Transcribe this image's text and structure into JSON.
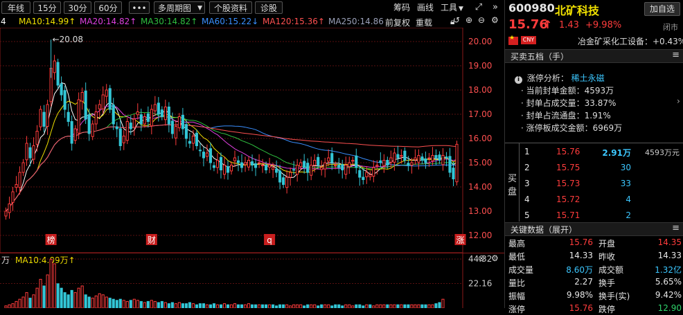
{
  "toolbar": {
    "btn_daily": "年线",
    "btn_15": "15分",
    "btn_30": "30分",
    "btn_60": "60分",
    "btn_more": "•••",
    "btn_multi": "多周期图",
    "btn_profile": "个股资料",
    "btn_diag": "诊股",
    "link_chips": "筹码",
    "link_draw": "画线",
    "link_tools": "工具"
  },
  "ma_bar": {
    "prefix": "4",
    "ma10": "MA10:14.99↑",
    "ma20": "MA20:14.82↑",
    "ma30": "MA30:14.82↑",
    "ma60": "MA60:15.22↓",
    "ma120": "MA120:15.36↑",
    "ma250": "MA250:14.86",
    "adj": "前复权",
    "redraw": "重载"
  },
  "colors": {
    "up": "#ff3c3c",
    "down": "#33c6d6",
    "ma5": "#ffffff",
    "ma10": "#f0e000",
    "ma20": "#e040e0",
    "ma30": "#2fbf3f",
    "ma60": "#3a8fff",
    "ma120": "#ff5050",
    "ma250": "#9aa0b8"
  },
  "chart_data": {
    "type": "candlestick",
    "ylim": [
      12.0,
      20.2
    ],
    "y_ticks": [
      "20.00",
      "19.00",
      "18.00",
      "17.00",
      "16.00",
      "15.00",
      "14.00",
      "13.00",
      "12.00"
    ],
    "y_tick_values": [
      20,
      19,
      18,
      17,
      16,
      15,
      14,
      13,
      12
    ],
    "annotation_high": "←20.08",
    "high_value": 20.08,
    "markers": [
      {
        "label": "榜",
        "index": 13
      },
      {
        "label": "财",
        "index": 42
      },
      {
        "label": "q",
        "index": 76
      },
      {
        "label": "涨",
        "index": 131
      }
    ],
    "closes": [
      13.0,
      13.3,
      13.8,
      14.1,
      14.6,
      15.0,
      15.8,
      15.2,
      15.7,
      16.3,
      17.2,
      16.5,
      17.4,
      18.9,
      19.2,
      18.2,
      17.8,
      17.2,
      16.7,
      15.8,
      16.4,
      17.6,
      17.9,
      16.8,
      16.2,
      16.6,
      17.1,
      17.4,
      17.8,
      18.0,
      17.2,
      16.6,
      16.4,
      15.7,
      16.1,
      16.7,
      16.4,
      16.8,
      17.1,
      16.6,
      16.9,
      16.7,
      17.2,
      17.4,
      17.0,
      16.9,
      17.3,
      16.6,
      16.2,
      16.5,
      16.9,
      16.4,
      16.0,
      15.8,
      16.1,
      15.7,
      15.5,
      15.2,
      15.4,
      15.0,
      14.8,
      15.1,
      14.7,
      14.9,
      14.6,
      14.9,
      15.2,
      15.0,
      14.8,
      15.0,
      15.1,
      14.9,
      14.8,
      15.0,
      14.9,
      14.7,
      14.9,
      14.8,
      14.6,
      14.2,
      14.1,
      14.4,
      14.6,
      14.7,
      14.9,
      15.0,
      14.8,
      14.6,
      14.9,
      15.1,
      14.9,
      14.8,
      15.0,
      15.2,
      15.0,
      14.9,
      14.8,
      14.7,
      14.9,
      15.0,
      15.1,
      14.8,
      14.4,
      14.3,
      14.6,
      14.5,
      14.8,
      14.9,
      15.0,
      15.1,
      14.9,
      15.2,
      15.4,
      15.2,
      15.3,
      15.1,
      14.9,
      15.0,
      15.2,
      15.3,
      15.1,
      15.0,
      15.2,
      15.3,
      15.2,
      15.1,
      15.3,
      15.2,
      14.6,
      14.33,
      15.76
    ],
    "volume": {
      "label_ma10": "MA10:4.09万↑",
      "label_prefix": "万",
      "y_ticks": [
        "44.32",
        "22.16"
      ],
      "y_tick_values": [
        44.32,
        22.16
      ],
      "ylim": [
        0,
        50
      ],
      "values": [
        2,
        3,
        4,
        6,
        8,
        10,
        14,
        9,
        12,
        18,
        26,
        20,
        30,
        44,
        40,
        22,
        18,
        14,
        12,
        16,
        14,
        18,
        20,
        12,
        10,
        9,
        11,
        13,
        12,
        10,
        9,
        8,
        7,
        8,
        7,
        6,
        7,
        8,
        7,
        6,
        5,
        6,
        7,
        6,
        5,
        6,
        5,
        4,
        5,
        4,
        5,
        4,
        4,
        5,
        4,
        3,
        4,
        4,
        3,
        3,
        4,
        3,
        3,
        4,
        3,
        3,
        4,
        3,
        3,
        3,
        4,
        3,
        3,
        3,
        3,
        3,
        3,
        3,
        2,
        3,
        3,
        3,
        2,
        3,
        3,
        3,
        2,
        3,
        3,
        3,
        2,
        3,
        3,
        3,
        2,
        3,
        3,
        2,
        3,
        3,
        2,
        3,
        3,
        2,
        3,
        3,
        2,
        3,
        3,
        3,
        3,
        3,
        3,
        3,
        3,
        3,
        3,
        3,
        3,
        3,
        3,
        3,
        3,
        3,
        4,
        5,
        8
      ]
    }
  },
  "quote": {
    "code": "600980",
    "name": "北矿科技",
    "add_fav": "加自选",
    "price": "15.76",
    "arrow": "↑",
    "change": "1.43",
    "pct": "+9.98%",
    "status": "闭市",
    "currency_badge": "CNY",
    "industry": "冶金矿采化工设备：+0.43%"
  },
  "order_book_header": "买卖五档（手）",
  "limit_analysis": {
    "title": "涨停分析：",
    "tag": "稀土永磁",
    "items": [
      "· 当前封单金额：4593万",
      "· 封单占成交量：33.87%",
      "· 封单占流通盘：1.91%",
      "· 涨停板成交金额：6969万"
    ]
  },
  "bids": {
    "side_label": [
      "买",
      "盘"
    ],
    "rows": [
      {
        "level": "1",
        "price": "15.76",
        "vol": "2.91万",
        "note": "4593万元"
      },
      {
        "level": "2",
        "price": "15.75",
        "vol": "30",
        "note": ""
      },
      {
        "level": "3",
        "price": "15.73",
        "vol": "33",
        "note": ""
      },
      {
        "level": "4",
        "price": "15.72",
        "vol": "4",
        "note": ""
      },
      {
        "level": "5",
        "price": "15.71",
        "vol": "2",
        "note": ""
      }
    ]
  },
  "key_header": "关键数据（展开）",
  "key_data": [
    {
      "l1": "最高",
      "v1": "15.76",
      "c1": "red",
      "l2": "开盘",
      "v2": "14.35",
      "c2": "red"
    },
    {
      "l1": "最低",
      "v1": "14.33",
      "c1": "white",
      "l2": "昨收",
      "v2": "14.33",
      "c2": "white"
    },
    {
      "l1": "成交量",
      "v1": "8.60万",
      "c1": "cyan",
      "l2": "成交额",
      "v2": "1.32亿",
      "c2": "cyan"
    },
    {
      "l1": "量比",
      "v1": "2.27",
      "c1": "white",
      "l2": "换手",
      "v2": "5.65%",
      "c2": "white"
    },
    {
      "l1": "振幅",
      "v1": "9.98%",
      "c1": "white",
      "l2": "换手(实)",
      "v2": "9.42%",
      "c2": "white"
    },
    {
      "l1": "涨停",
      "v1": "15.76",
      "c1": "red",
      "l2": "跌停",
      "v2": "12.90",
      "c2": "green"
    }
  ]
}
